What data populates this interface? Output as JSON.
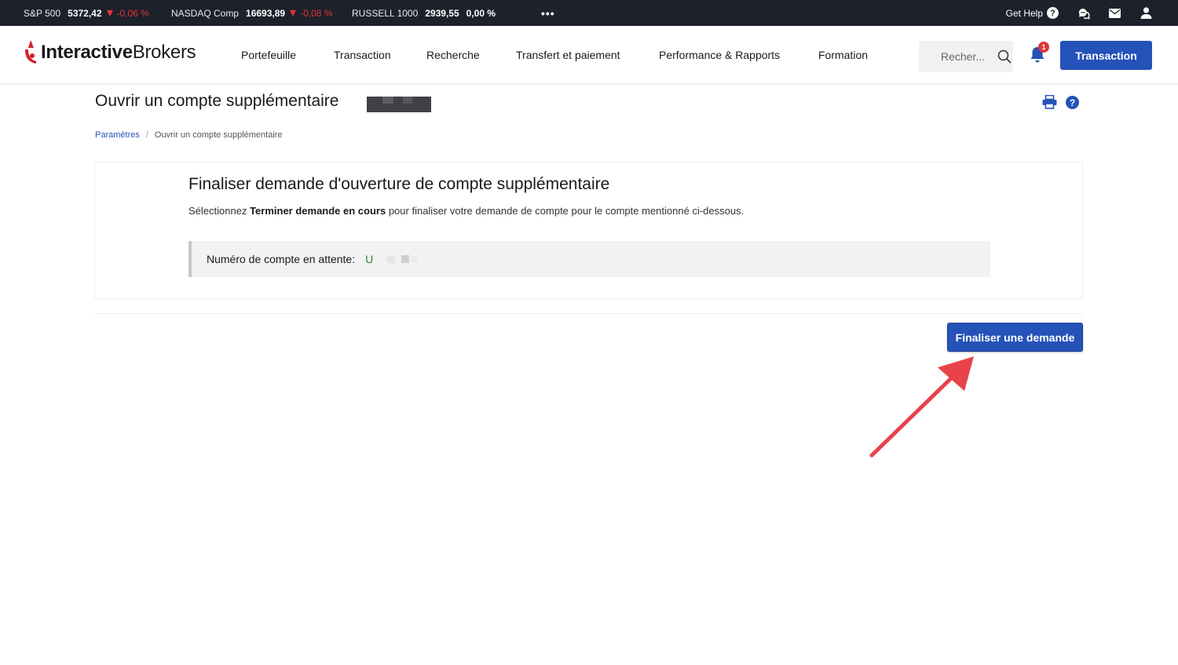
{
  "ticker": {
    "items": [
      {
        "name": "S&P 500",
        "value": "5372,42",
        "change": "-0,06 %",
        "direction": "down"
      },
      {
        "name": "NASDAQ Comp",
        "value": "16693,89",
        "change": "-0,08 %",
        "direction": "down"
      },
      {
        "name": "RUSSELL 1000",
        "value": "2939,55",
        "change": "0,00 %",
        "direction": "flat"
      }
    ],
    "more": "•••",
    "get_help": "Get Help"
  },
  "header": {
    "logo_bold": "Interactive",
    "logo_regular": "Brokers",
    "nav": [
      "Portefeuille",
      "Transaction",
      "Recherche",
      "Transfert et paiement",
      "Performance & Rapports",
      "Formation"
    ],
    "search_placeholder": "Recher...",
    "notification_count": "1",
    "trade_button": "Transaction"
  },
  "page": {
    "title": "Ouvrir un compte supplémentaire",
    "breadcrumb": [
      "Paramètres",
      "Ouvrir un compte supplémentaire"
    ],
    "breadcrumb_sep": "/"
  },
  "card": {
    "title": "Finaliser demande d'ouverture de compte supplémentaire",
    "desc_before": "Sélectionnez ",
    "desc_bold": "Terminer demande en cours",
    "desc_after": " pour finaliser votre demande de compte pour le compte mentionné ci-dessous.",
    "pending_label": "Numéro de compte en attente:",
    "pending_account": "U"
  },
  "actions": {
    "finalize_button": "Finaliser une demande"
  },
  "colors": {
    "brand_blue": "#2452b8",
    "ticker_bg": "#1c212b",
    "negative": "#e0353b",
    "account_green": "#2e8540",
    "annotation_arrow": "#e8434b"
  }
}
